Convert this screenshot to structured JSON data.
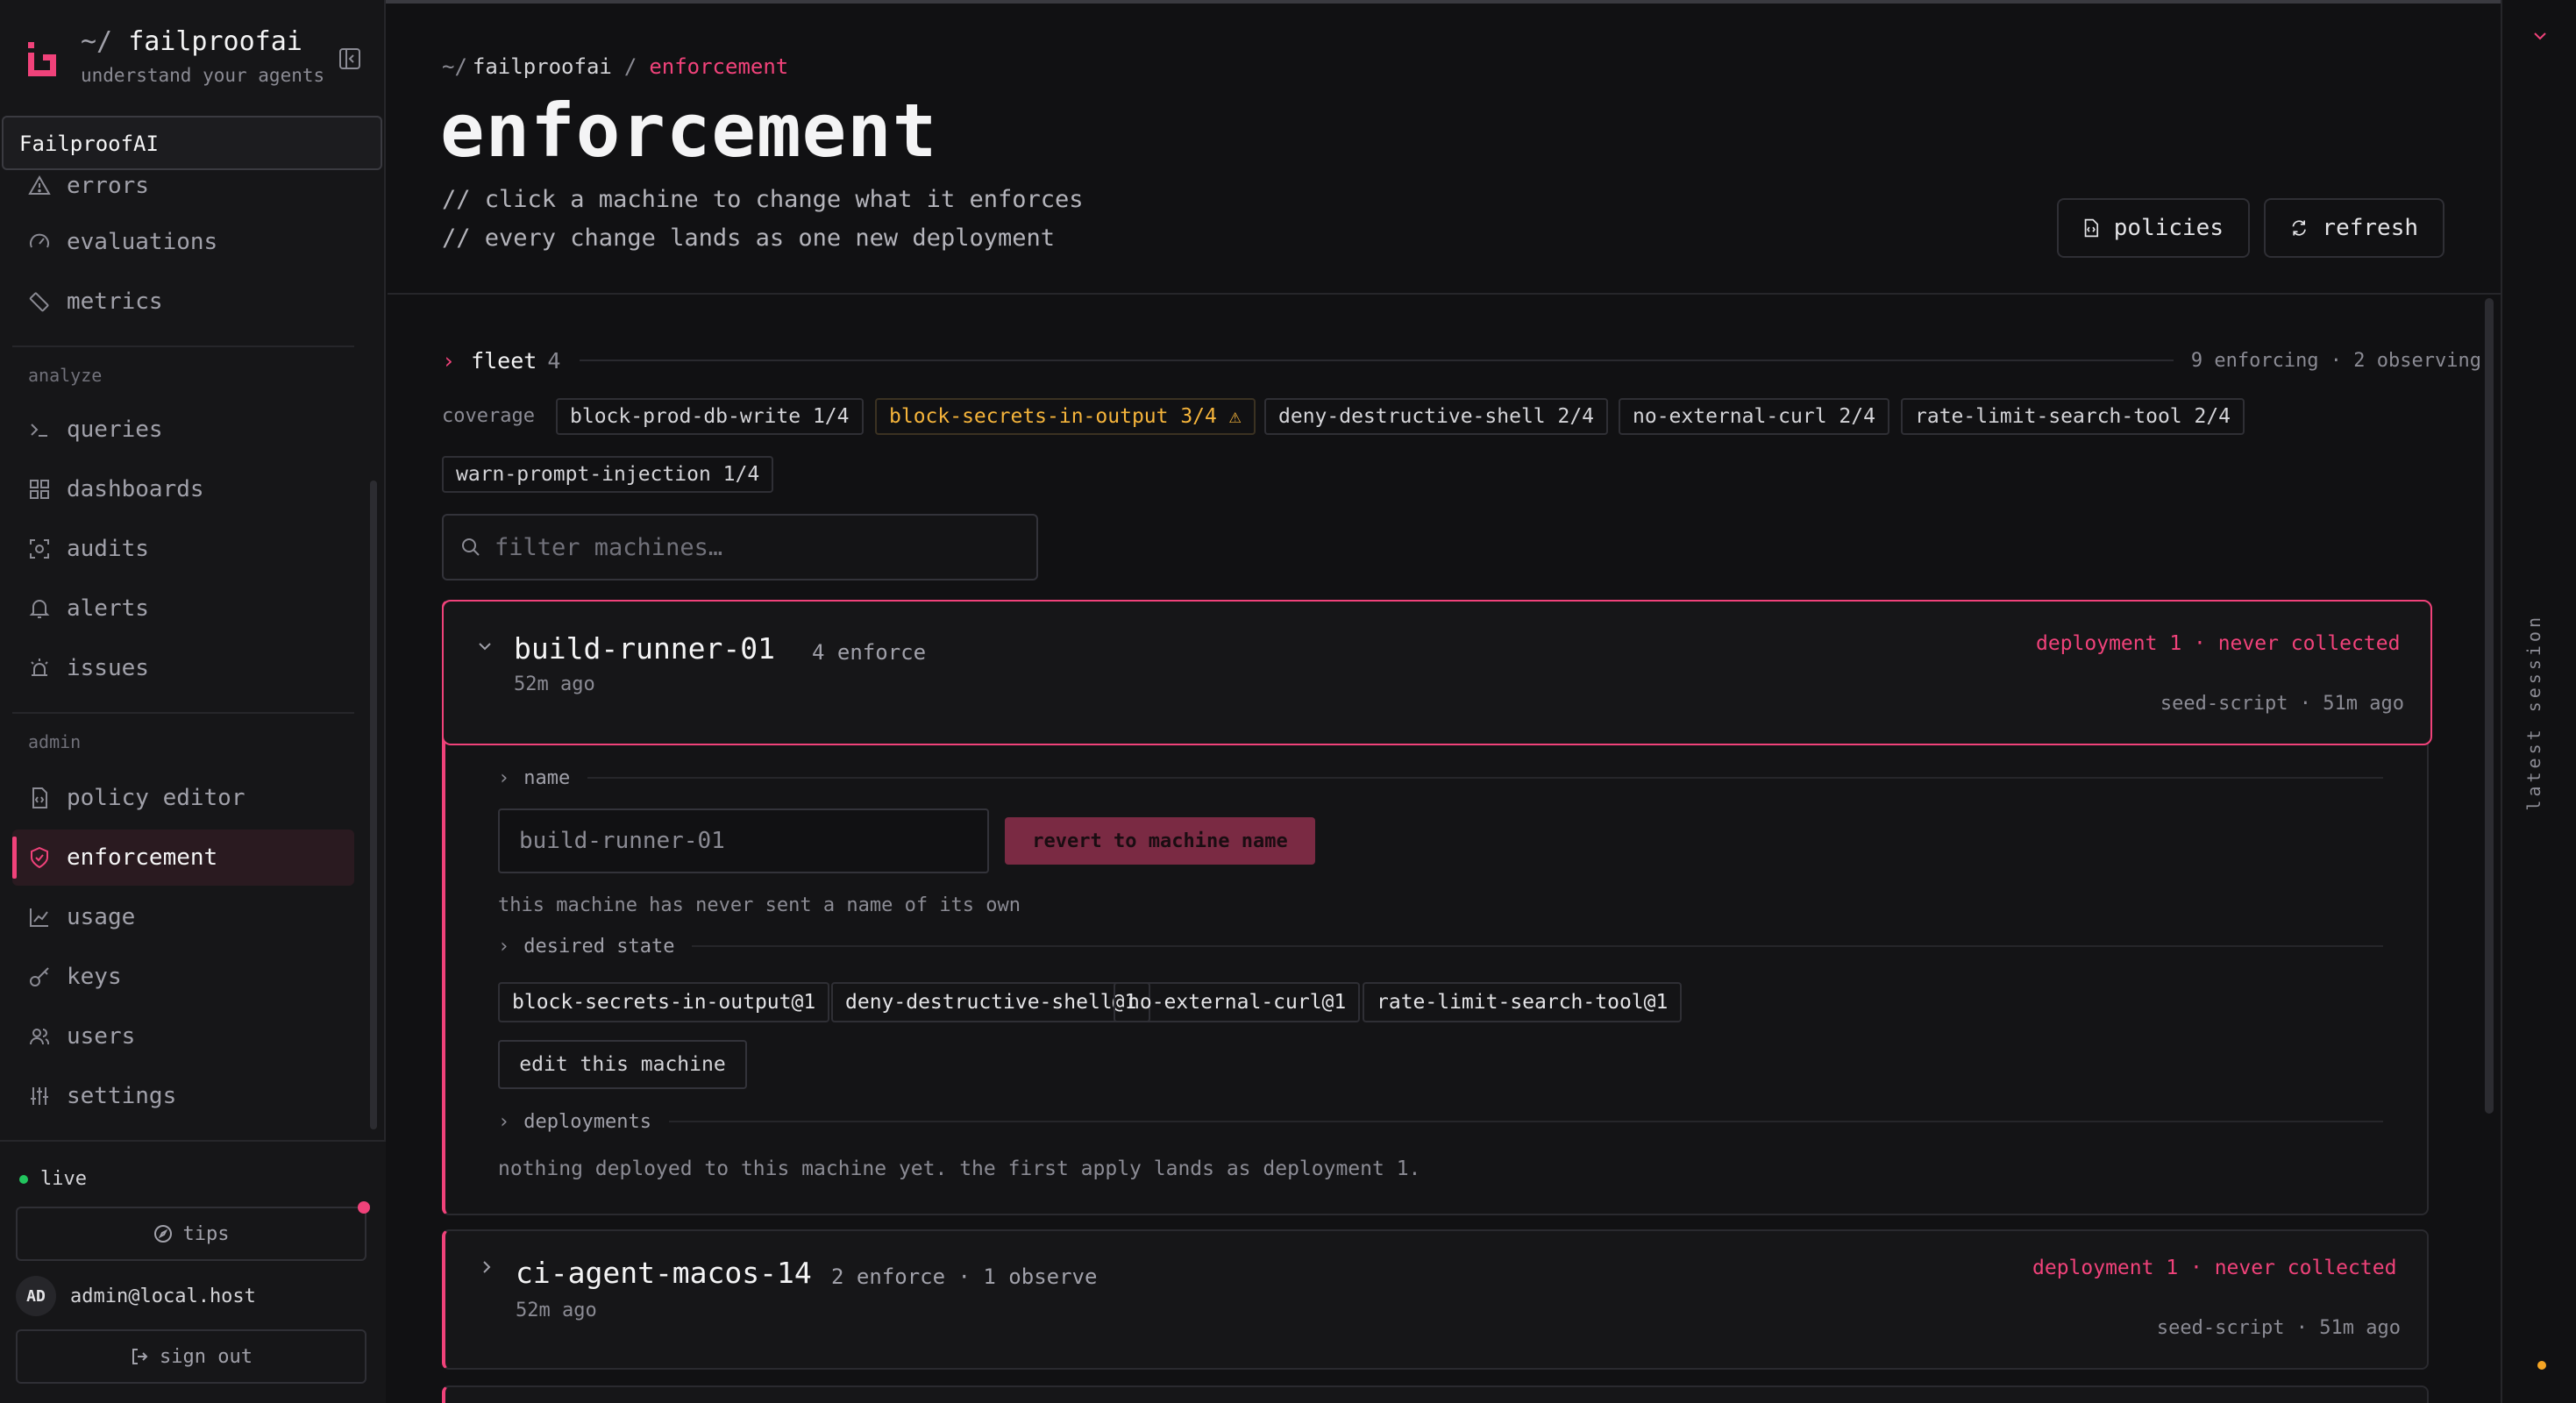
{
  "app": {
    "prefix": "~/",
    "name": "failproofai",
    "tagline": "understand your agents"
  },
  "tooltip": "FailproofAI",
  "nav": {
    "top_items": [
      {
        "label": "errors",
        "icon": "warning-icon"
      },
      {
        "label": "evaluations",
        "icon": "gauge-icon"
      },
      {
        "label": "metrics",
        "icon": "ruler-icon"
      }
    ],
    "analyze_label": "analyze",
    "analyze_items": [
      {
        "label": "queries",
        "icon": "terminal-icon"
      },
      {
        "label": "dashboards",
        "icon": "grid-icon"
      },
      {
        "label": "audits",
        "icon": "scan-icon"
      },
      {
        "label": "alerts",
        "icon": "bell-icon"
      },
      {
        "label": "issues",
        "icon": "siren-icon"
      }
    ],
    "admin_label": "admin",
    "admin_items": [
      {
        "label": "policy editor",
        "icon": "file-code-icon"
      },
      {
        "label": "enforcement",
        "icon": "shield-icon",
        "active": true
      },
      {
        "label": "usage",
        "icon": "chart-icon"
      },
      {
        "label": "keys",
        "icon": "key-icon"
      },
      {
        "label": "users",
        "icon": "users-icon"
      },
      {
        "label": "settings",
        "icon": "sliders-icon"
      }
    ]
  },
  "footer": {
    "status": "live",
    "tips": "tips",
    "avatar": "AD",
    "email": "admin@local.host",
    "signout": "sign out"
  },
  "breadcrumb": {
    "home": "~/",
    "root": "failproofai",
    "sep": "/",
    "current": "enforcement"
  },
  "page": {
    "title": "enforcement",
    "subtitle1": "// click a machine to change what it enforces",
    "subtitle2": "// every change lands as one new deployment",
    "policies_btn": "policies",
    "refresh_btn": "refresh"
  },
  "fleet": {
    "label": "fleet",
    "count": "4",
    "stats": "9 enforcing · 2 observing",
    "coverage_label": "coverage",
    "coverage": [
      {
        "text": "block-prod-db-write 1/4"
      },
      {
        "text": "block-secrets-in-output 3/4 ⚠",
        "warn": true
      },
      {
        "text": "deny-destructive-shell 2/4"
      },
      {
        "text": "no-external-curl 2/4"
      },
      {
        "text": "rate-limit-search-tool 2/4"
      },
      {
        "text": "warn-prompt-injection 1/4"
      }
    ],
    "filter_placeholder": "filter machines…"
  },
  "machines": [
    {
      "name": "build-runner-01",
      "meta": "4 enforce",
      "age": "52m ago",
      "deploy": "deployment 1 · never collected",
      "seed": "seed-script · 51m ago",
      "sections": {
        "name": "name",
        "desired": "desired state",
        "deployments": "deployments"
      },
      "name_value": "build-runner-01",
      "revert": "revert to machine name",
      "name_note": "this machine has never sent a name of its own",
      "policies": [
        "block-secrets-in-output@1",
        "deny-destructive-shell@1",
        "no-external-curl@1",
        "rate-limit-search-tool@1"
      ],
      "edit": "edit this machine",
      "deploy_note": "nothing deployed to this machine yet. the first apply lands as deployment 1."
    },
    {
      "name": "ci-agent-macos-14",
      "meta": "2 enforce · 1 observe",
      "age": "52m ago",
      "deploy": "deployment 1 · never collected",
      "seed": "seed-script · 51m ago"
    }
  ],
  "rail": {
    "label": "latest session"
  },
  "colors": {
    "accent": "#f0427a",
    "warn": "#f5b43b",
    "live": "#22c55e"
  }
}
